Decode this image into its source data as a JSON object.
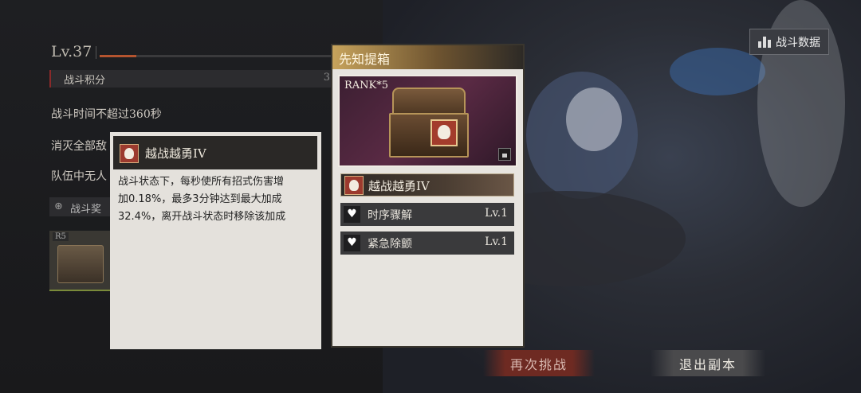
{
  "level": {
    "label": "Lv.37",
    "progress": 0.16
  },
  "battle_score": {
    "label": "战斗积分",
    "value": "3"
  },
  "conditions": [
    "战斗时间不超过360秒",
    "消灭全部敌",
    "队伍中无人"
  ],
  "reward_section": {
    "icon": "gear-icon",
    "label": "战斗奖"
  },
  "reward_item": {
    "badge": "R5"
  },
  "tooltip": {
    "title": "越战越勇IV",
    "lines": [
      "战斗状态下，每秒使所有招式伤害增",
      "加0.18%，最多3分钟达到最大加成",
      "32.4%，离开战斗状态时移除该加成"
    ]
  },
  "card": {
    "title": "先知提箱",
    "rank": "RANK*5",
    "main_skill": "越战越勇IV",
    "skills": [
      {
        "name": "时序骤解",
        "level": "Lv.1",
        "icon": "heart-icon"
      },
      {
        "name": "紧急除颤",
        "level": "Lv.1",
        "icon": "heart-icon"
      }
    ]
  },
  "stats_button": {
    "label": "战斗数据",
    "icon": "bar-chart-icon"
  },
  "retry_button": {
    "label": "再次挑战"
  },
  "exit_button": {
    "label": "退出副本"
  },
  "colors": {
    "accent_gold": "#c7a35c",
    "retry_red": "#6e2a22",
    "progress": "#b4542f"
  }
}
